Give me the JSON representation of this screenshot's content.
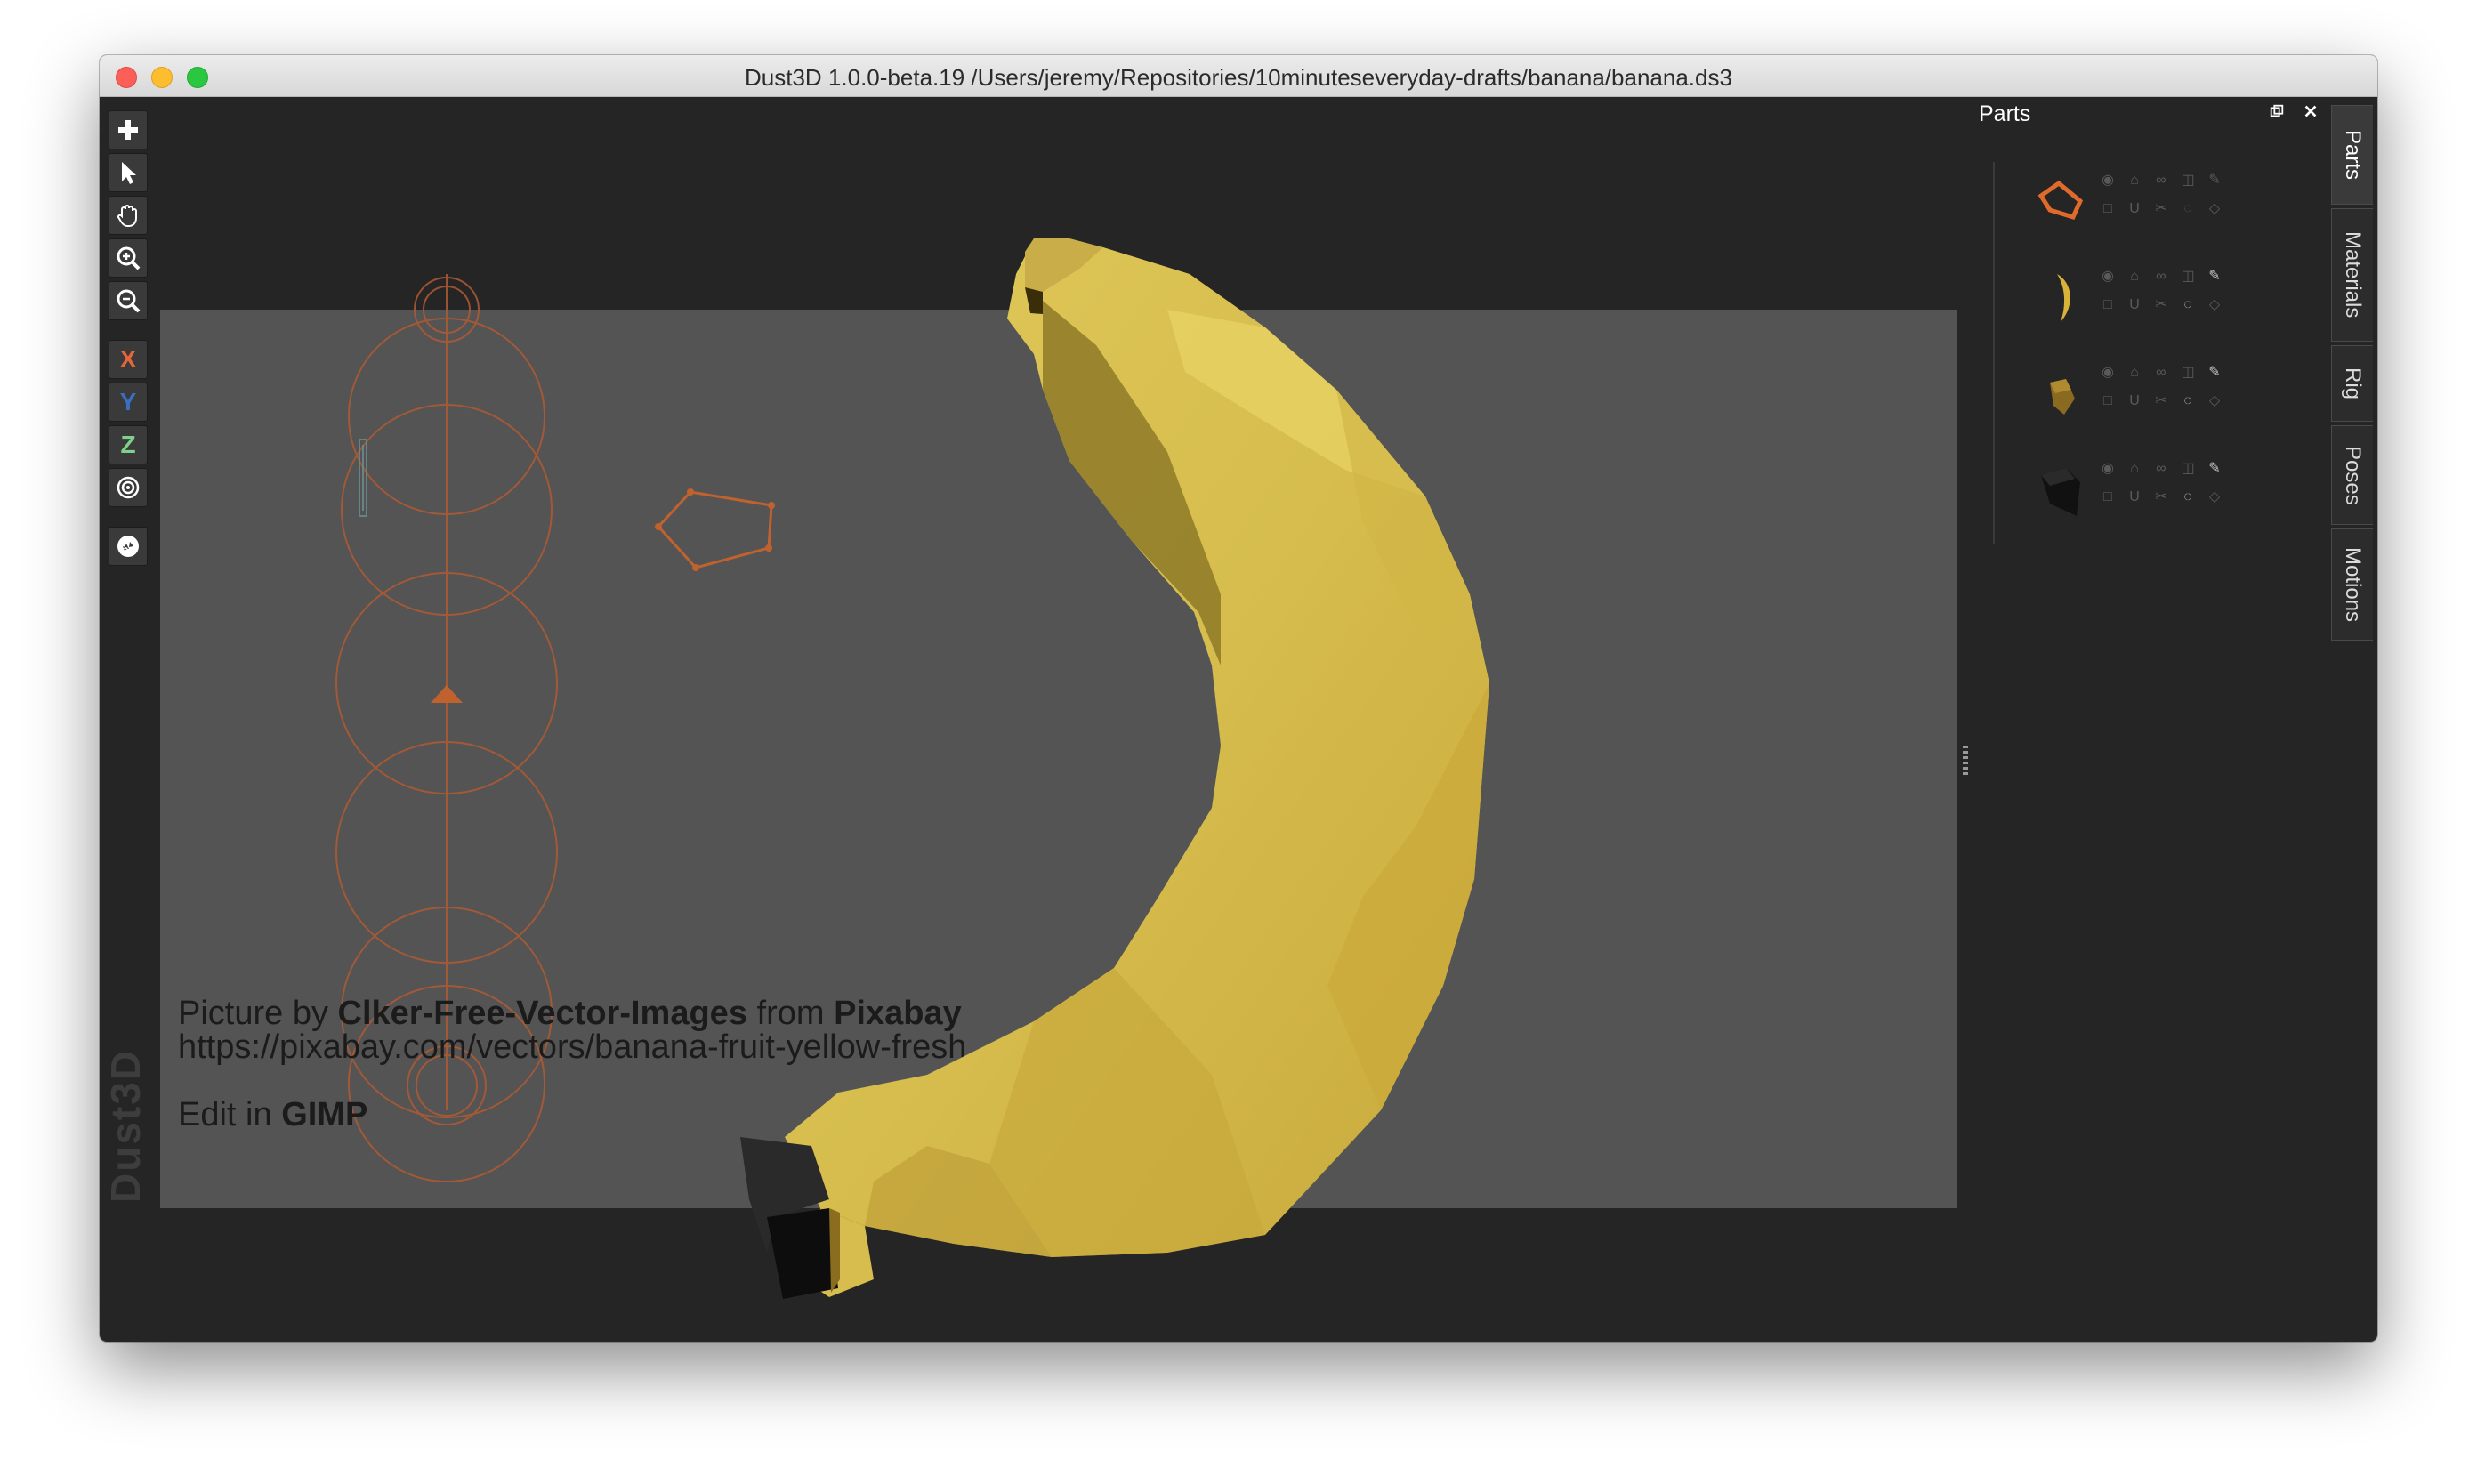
{
  "window": {
    "title": "Dust3D 1.0.0-beta.19 /Users/jeremy/Repositories/10minuteseveryday-drafts/banana/banana.ds3"
  },
  "toolbar": {
    "buttons": [
      {
        "name": "add",
        "icon": "plus-icon"
      },
      {
        "name": "select",
        "icon": "pointer-icon"
      },
      {
        "name": "drag",
        "icon": "hand-icon"
      },
      {
        "name": "zoom-in",
        "icon": "zoom-in-icon"
      },
      {
        "name": "zoom-out",
        "icon": "zoom-out-icon"
      },
      {
        "name": "x-lock",
        "label": "X",
        "color": "#e8653a"
      },
      {
        "name": "y-lock",
        "label": "Y",
        "color": "#3a6fbf"
      },
      {
        "name": "z-lock",
        "label": "Z",
        "color": "#7ed08a"
      },
      {
        "name": "radius-lock",
        "icon": "target-icon"
      },
      {
        "name": "regenerate",
        "icon": "recycle-icon"
      }
    ]
  },
  "brand": "Dust3D",
  "reference_image": {
    "credit_prefix": "Picture by",
    "credit_author": "Clker-Free-Vector-Images",
    "credit_mid": "from",
    "credit_site": "Pixabay",
    "credit_url": "https://pixabay.com/vectors/banana-fruit-yellow-fresh",
    "edit_prefix": "Edit in",
    "edit_app": "GIMP"
  },
  "parts_panel": {
    "title": "Parts",
    "parts": [
      {
        "name": "outline-part",
        "color": "#e06a2a"
      },
      {
        "name": "banana-body-part",
        "color": "#d9b23a"
      },
      {
        "name": "stem-part",
        "color": "#8a6a20"
      },
      {
        "name": "tip-part",
        "color": "#111111"
      }
    ]
  },
  "side_tabs": [
    "Parts",
    "Materials",
    "Rig",
    "Poses",
    "Motions"
  ],
  "colors": {
    "accent": "#e06a2a",
    "banana": "#d9bf4f",
    "background": "#252525",
    "reference": "#545454"
  }
}
